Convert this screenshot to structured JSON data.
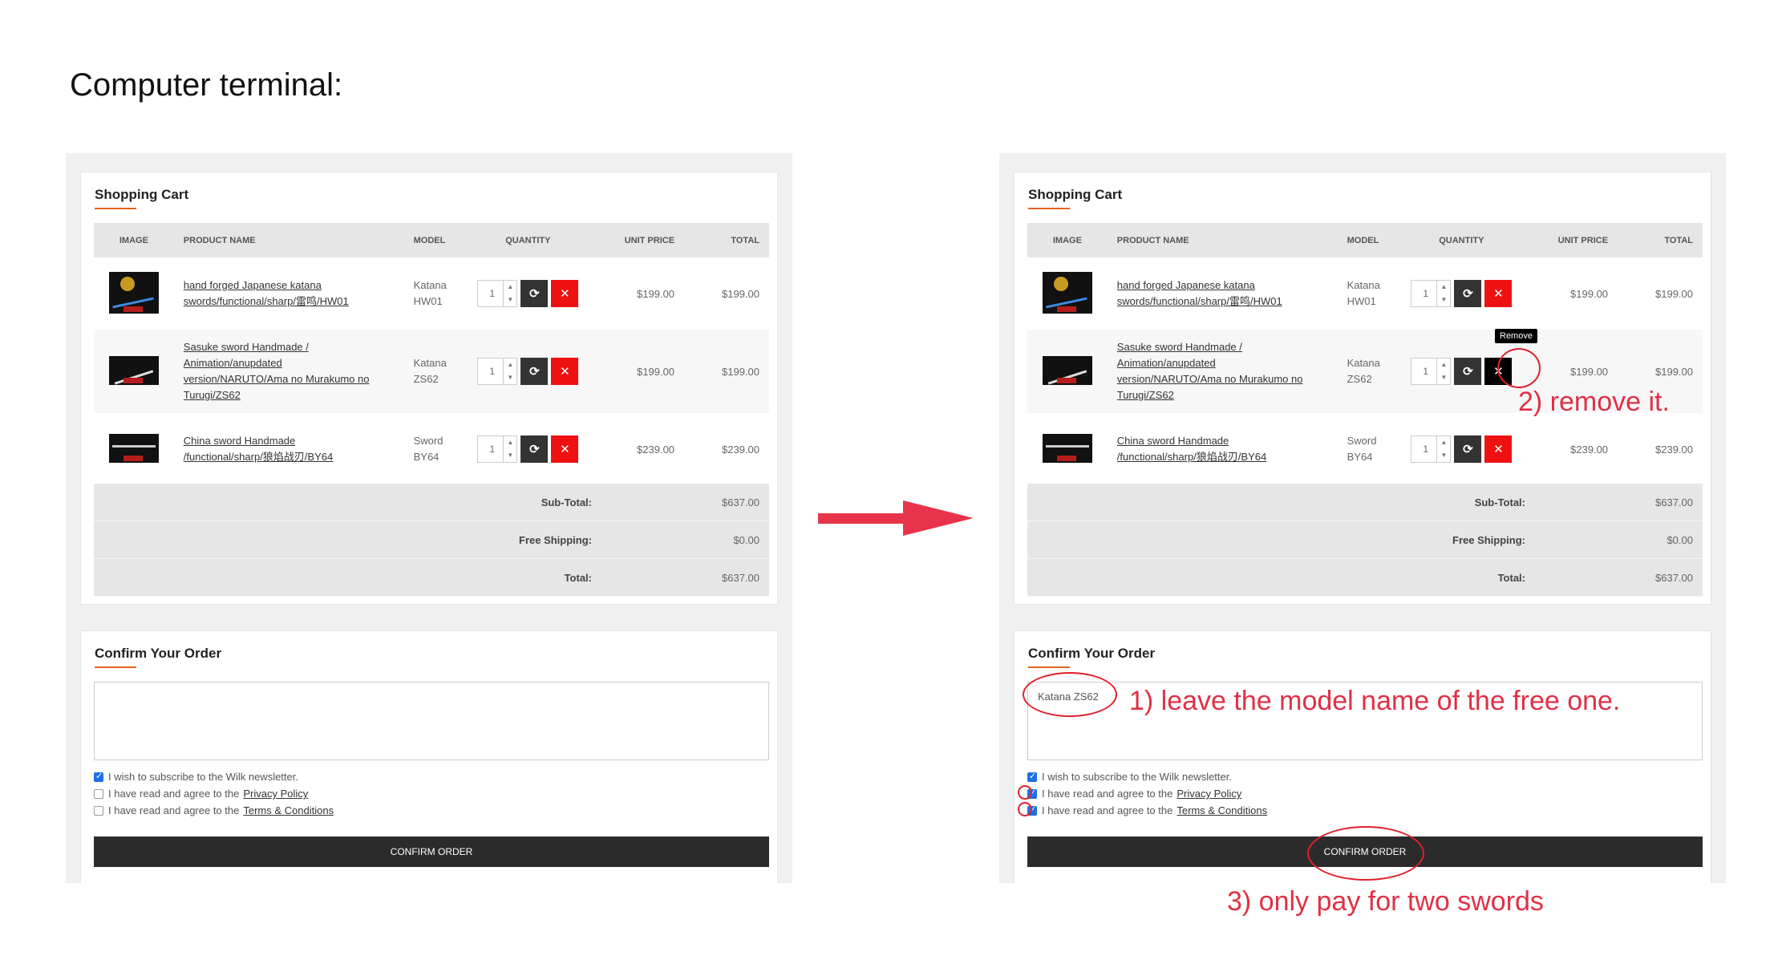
{
  "page_heading": "Computer terminal:",
  "cart": {
    "title": "Shopping Cart",
    "columns": [
      "Image",
      "Product Name",
      "Model",
      "Quantity",
      "Unit Price",
      "Total"
    ],
    "items": [
      {
        "name_line1": "hand forged Japanese katana",
        "name_line2": "swords/functional/sharp/雷鸣/HW01",
        "model_line1": "Katana",
        "model_line2": "HW01",
        "qty": "1",
        "unit_price": "$199.00",
        "total": "$199.00"
      },
      {
        "name_line1": "Sasuke sword Handmade /",
        "name_line2": "Animation/anupdated",
        "name_line3": "version/NARUTO/Ama no Murakumo no",
        "name_line4": "Turugi/ZS62",
        "model_line1": "Katana",
        "model_line2": "ZS62",
        "qty": "1",
        "unit_price": "$199.00",
        "total": "$199.00"
      },
      {
        "name_line1": "China sword Handmade",
        "name_line2": "/functional/sharp/狼焰战刃/BY64",
        "model_line1": "Sword",
        "model_line2": "BY64",
        "qty": "1",
        "unit_price": "$239.00",
        "total": "$239.00"
      }
    ],
    "totals": [
      {
        "label": "Sub-Total:",
        "value": "$637.00"
      },
      {
        "label": "Free Shipping:",
        "value": "$0.00"
      },
      {
        "label": "Total:",
        "value": "$637.00"
      }
    ]
  },
  "confirm": {
    "title": "Confirm Your Order",
    "comment_value_right": "Katana ZS62",
    "newsletter_label": "I wish to subscribe to the Wilk newsletter.",
    "agree_prefix": "I have read and agree to the",
    "privacy_link": "Privacy Policy",
    "terms_link": "Terms & Conditions",
    "button_label": "CONFIRM ORDER",
    "left_checks": {
      "newsletter": true,
      "privacy": false,
      "terms": false
    },
    "right_checks": {
      "newsletter": true,
      "privacy": true,
      "terms": true
    }
  },
  "annotations": {
    "tooltip_remove": "Remove",
    "step1": "1) leave the model name of the free one.",
    "step2": "2) remove it.",
    "step3": "3) only pay for two swords",
    "color": "#e03046"
  },
  "icons": {
    "refresh": "refresh-icon",
    "remove": "close-icon",
    "arrow": "arrow-right-icon"
  }
}
